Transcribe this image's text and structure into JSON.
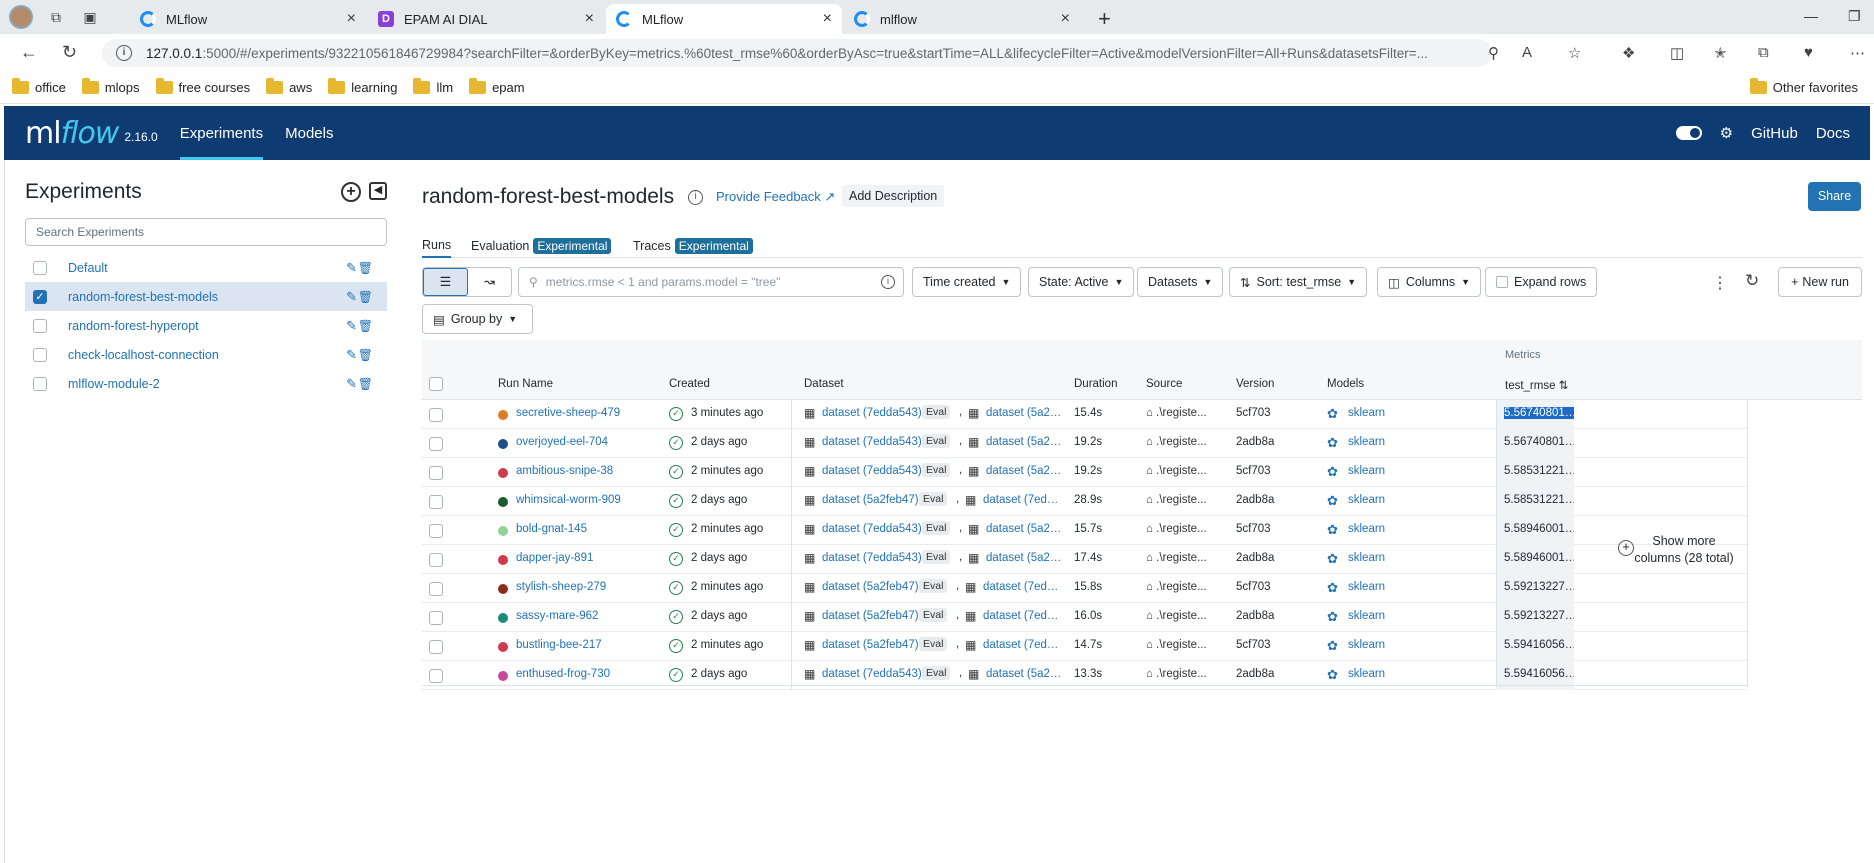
{
  "browser": {
    "tabs": [
      {
        "title": "MLflow"
      },
      {
        "title": "EPAM AI DIAL"
      },
      {
        "title": "MLflow"
      },
      {
        "title": "mlflow"
      }
    ],
    "url_host": "127.0.0.1",
    "url_rest": ":5000/#/experiments/932210561846729984?searchFilter=&orderByKey=metrics.%60test_rmse%60&orderByAsc=true&startTime=ALL&lifecycleFilter=Active&modelVersionFilter=All+Runs&datasetsFilter=...",
    "bookmarks": [
      "office",
      "mlops",
      "free courses",
      "aws",
      "learning",
      "llm",
      "epam"
    ],
    "other_favorites": "Other favorites"
  },
  "header": {
    "logo_ml": "ml",
    "logo_flow": "flow",
    "version": "2.16.0",
    "nav": [
      "Experiments",
      "Models"
    ],
    "github": "GitHub",
    "docs": "Docs"
  },
  "sidebar": {
    "title": "Experiments",
    "search_placeholder": "Search Experiments",
    "items": [
      {
        "name": "Default",
        "selected": false
      },
      {
        "name": "random-forest-best-models",
        "selected": true
      },
      {
        "name": "random-forest-hyperopt",
        "selected": false
      },
      {
        "name": "check-localhost-connection",
        "selected": false
      },
      {
        "name": "mlflow-module-2",
        "selected": false
      }
    ]
  },
  "main": {
    "title": "random-forest-best-models",
    "feedback": "Provide Feedback",
    "add_description": "Add Description",
    "share": "Share",
    "tabs": [
      {
        "label": "Runs"
      },
      {
        "label": "Evaluation",
        "badge": "Experimental"
      },
      {
        "label": "Traces",
        "badge": "Experimental"
      }
    ],
    "search_placeholder": "metrics.rmse < 1 and params.model = \"tree\"",
    "filters": {
      "time": "Time created",
      "state": "State: Active",
      "datasets": "Datasets",
      "sort": "Sort: test_rmse",
      "columns": "Columns",
      "expand": "Expand rows",
      "new_run": "New run",
      "group_by": "Group by"
    },
    "table": {
      "group_header": "Metrics",
      "columns": [
        "Run Name",
        "Created",
        "Dataset",
        "Duration",
        "Source",
        "Version",
        "Models",
        "test_rmse"
      ],
      "show_more": "Show more columns (28 total)",
      "rows": [
        {
          "color": "#e07b2a",
          "name": "secretive-sheep-479",
          "created": "3 minutes ago",
          "ds1": "dataset (7edda543)",
          "eval": "Eval",
          "ds2": "dataset (5a2…",
          "duration": "15.4s",
          "source": ".\\registe...",
          "version": "5cf703",
          "model": "sklearn",
          "metric": "5.56740801…"
        },
        {
          "color": "#1f4e8c",
          "name": "overjoyed-eel-704",
          "created": "2 days ago",
          "ds1": "dataset (7edda543)",
          "eval": "Eval",
          "ds2": "dataset (5a2…",
          "duration": "19.2s",
          "source": ".\\registe...",
          "version": "2adb8a",
          "model": "sklearn",
          "metric": "5.56740801…"
        },
        {
          "color": "#d13a4a",
          "name": "ambitious-snipe-38",
          "created": "2 minutes ago",
          "ds1": "dataset (7edda543)",
          "eval": "Eval",
          "ds2": "dataset (5a2…",
          "duration": "19.2s",
          "source": ".\\registe...",
          "version": "5cf703",
          "model": "sklearn",
          "metric": "5.58531221…"
        },
        {
          "color": "#1d5a2c",
          "name": "whimsical-worm-909",
          "created": "2 days ago",
          "ds1": "dataset (5a2feb47)",
          "eval": "Eval",
          "ds2": "dataset (7ed…",
          "duration": "28.9s",
          "source": ".\\registe...",
          "version": "2adb8a",
          "model": "sklearn",
          "metric": "5.58531221…"
        },
        {
          "color": "#8fd39a",
          "name": "bold-gnat-145",
          "created": "2 minutes ago",
          "ds1": "dataset (7edda543)",
          "eval": "Eval",
          "ds2": "dataset (5a2…",
          "duration": "15.7s",
          "source": ".\\registe...",
          "version": "5cf703",
          "model": "sklearn",
          "metric": "5.58946001…"
        },
        {
          "color": "#d13a4a",
          "name": "dapper-jay-891",
          "created": "2 days ago",
          "ds1": "dataset (7edda543)",
          "eval": "Eval",
          "ds2": "dataset (5a2…",
          "duration": "17.4s",
          "source": ".\\registe...",
          "version": "2adb8a",
          "model": "sklearn",
          "metric": "5.58946001…"
        },
        {
          "color": "#8c2f1a",
          "name": "stylish-sheep-279",
          "created": "2 minutes ago",
          "ds1": "dataset (5a2feb47)",
          "eval": "Eval",
          "ds2": "dataset (7ed…",
          "duration": "15.8s",
          "source": ".\\registe...",
          "version": "5cf703",
          "model": "sklearn",
          "metric": "5.59213227…"
        },
        {
          "color": "#1a8a7a",
          "name": "sassy-mare-962",
          "created": "2 days ago",
          "ds1": "dataset (5a2feb47)",
          "eval": "Eval",
          "ds2": "dataset (7ed…",
          "duration": "16.0s",
          "source": ".\\registe...",
          "version": "2adb8a",
          "model": "sklearn",
          "metric": "5.59213227…"
        },
        {
          "color": "#d13a4a",
          "name": "bustling-bee-217",
          "created": "2 minutes ago",
          "ds1": "dataset (5a2feb47)",
          "eval": "Eval",
          "ds2": "dataset (7ed…",
          "duration": "14.7s",
          "source": ".\\registe...",
          "version": "5cf703",
          "model": "sklearn",
          "metric": "5.59416056…"
        },
        {
          "color": "#c44a9a",
          "name": "enthused-frog-730",
          "created": "2 days ago",
          "ds1": "dataset (7edda543)",
          "eval": "Eval",
          "ds2": "dataset (5a2…",
          "duration": "13.3s",
          "source": ".\\registe...",
          "version": "2adb8a",
          "model": "sklearn",
          "metric": "5.59416056…"
        }
      ]
    }
  }
}
